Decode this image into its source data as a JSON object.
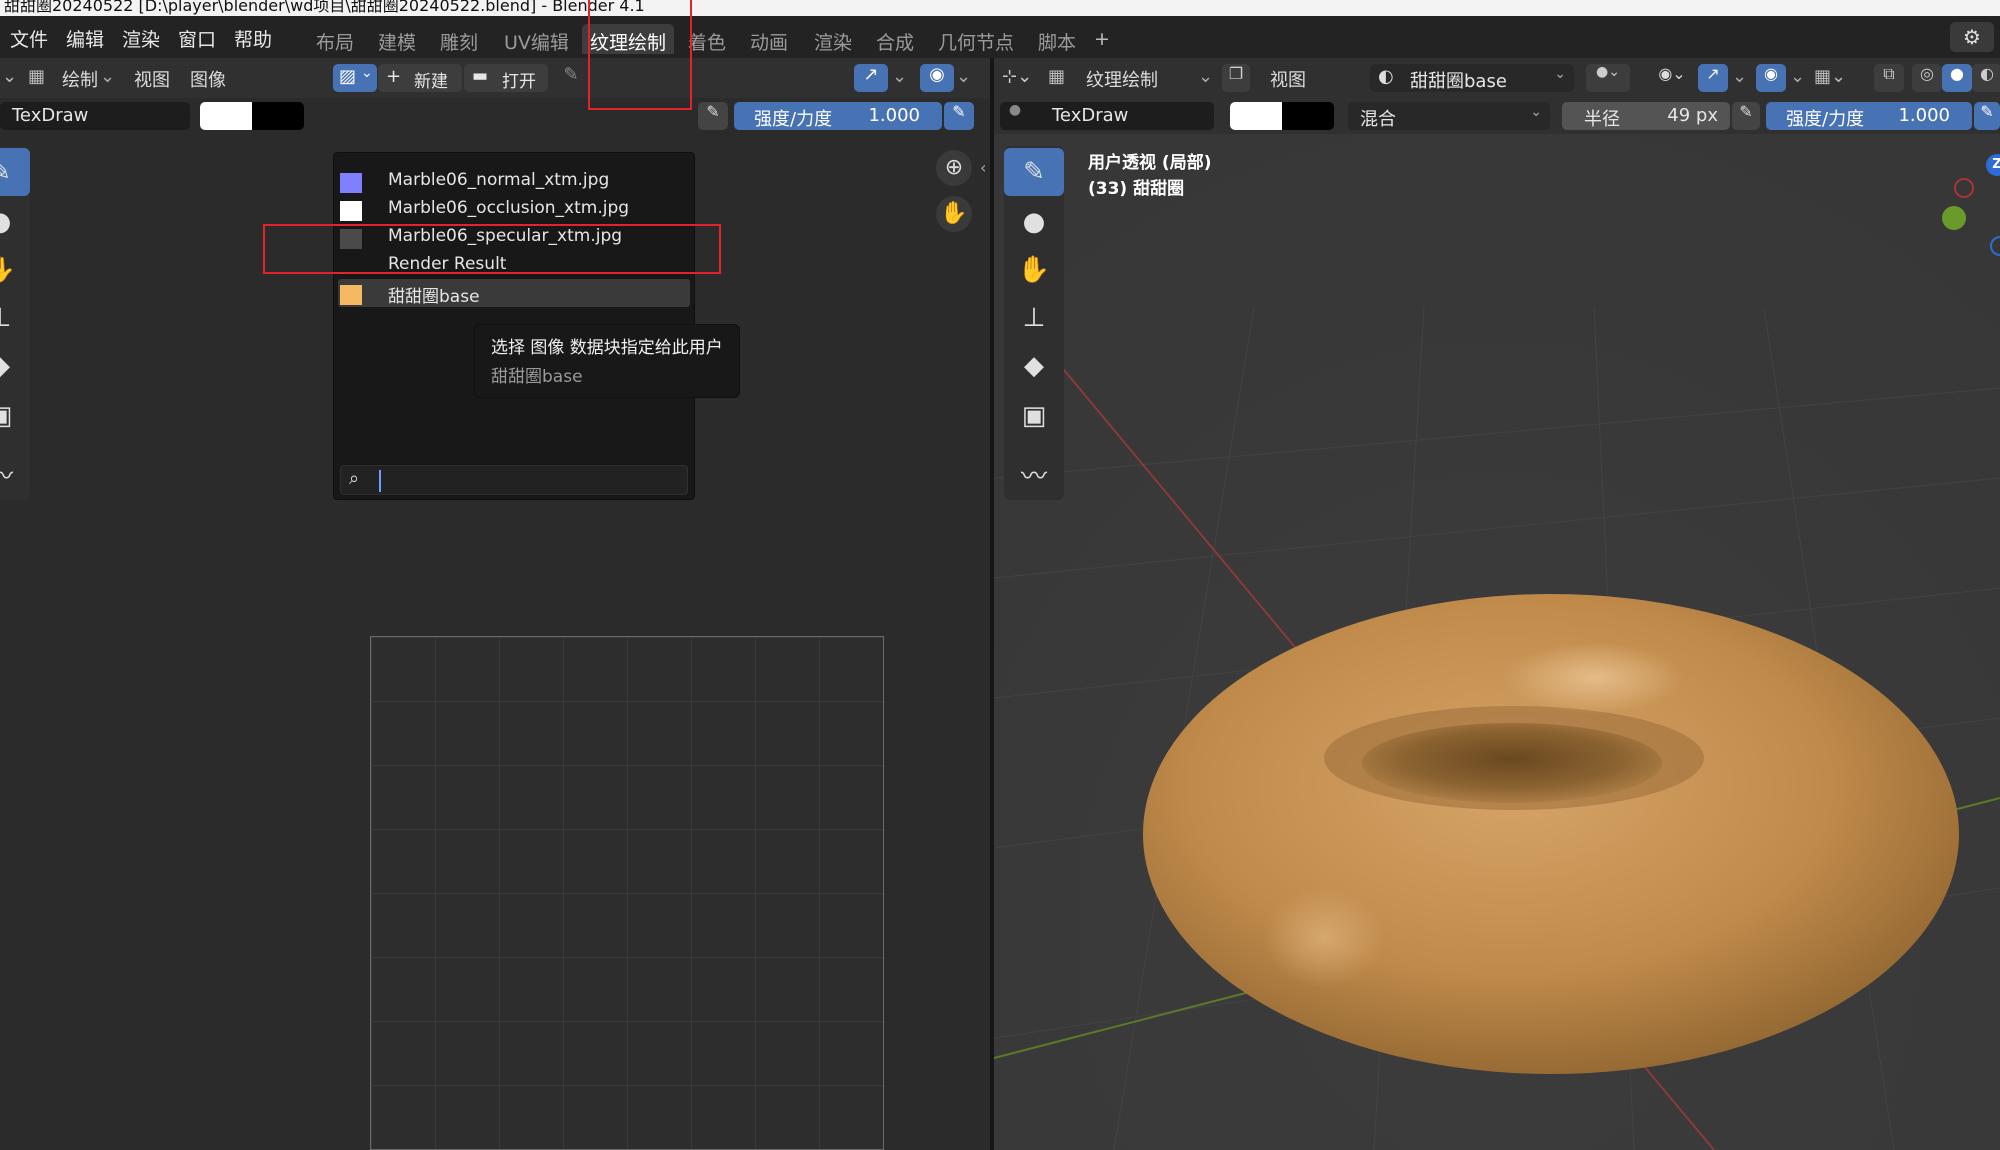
{
  "window_title": "甜甜圈20240522 [D:\\player\\blender\\wd项目\\甜甜圈20240522.blend] - Blender 4.1",
  "menu": [
    "文件",
    "编辑",
    "渲染",
    "窗口",
    "帮助"
  ],
  "workspace_tabs": [
    "布局",
    "建模",
    "雕刻",
    "UV编辑",
    "纹理绘制",
    "着色",
    "动画",
    "渲染",
    "合成",
    "几何节点",
    "脚本"
  ],
  "active_workspace": "纹理绘制",
  "add_tab": "+",
  "left_editor": {
    "mode_label": "绘制",
    "view_label": "视图",
    "image_label": "图像",
    "new_label": "新建",
    "open_label": "打开",
    "brush_name": "TexDraw",
    "strength_label": "强度/力度",
    "strength_value": "1.000"
  },
  "dropdown": {
    "items": [
      {
        "label": "Marble06_normal_xtm.jpg",
        "color": "#8080ff"
      },
      {
        "label": "Marble06_occlusion_xtm.jpg",
        "color": "#ffffff"
      },
      {
        "label": "Marble06_specular_xtm.jpg",
        "color": "#4a4a4a"
      },
      {
        "label": "Render Result",
        "color": ""
      },
      {
        "label": "甜甜圈base",
        "color": "#f5b961"
      }
    ],
    "highlighted": "甜甜圈base",
    "search_placeholder": ""
  },
  "tooltip": {
    "title": "选择 图像 数据块指定给此用户",
    "value": "甜甜圈base"
  },
  "right_editor": {
    "mode_label": "纹理绘制",
    "view_label": "视图",
    "image_name": "甜甜圈base",
    "brush_name": "TexDraw",
    "blend_label": "混合",
    "radius_label": "半径",
    "radius_value": "49 px",
    "strength_label": "强度/力度",
    "strength_value": "1.000",
    "viewport_line1": "用户透视 (局部)",
    "viewport_line2": "(33) 甜甜圈",
    "gizmo_z": "Z"
  },
  "colors": {
    "accent": "#4772b3",
    "highlight_box": "#e2232a",
    "donut": "#c48f4e",
    "primary_swatch": "#ffffff",
    "secondary_swatch": "#000000"
  }
}
